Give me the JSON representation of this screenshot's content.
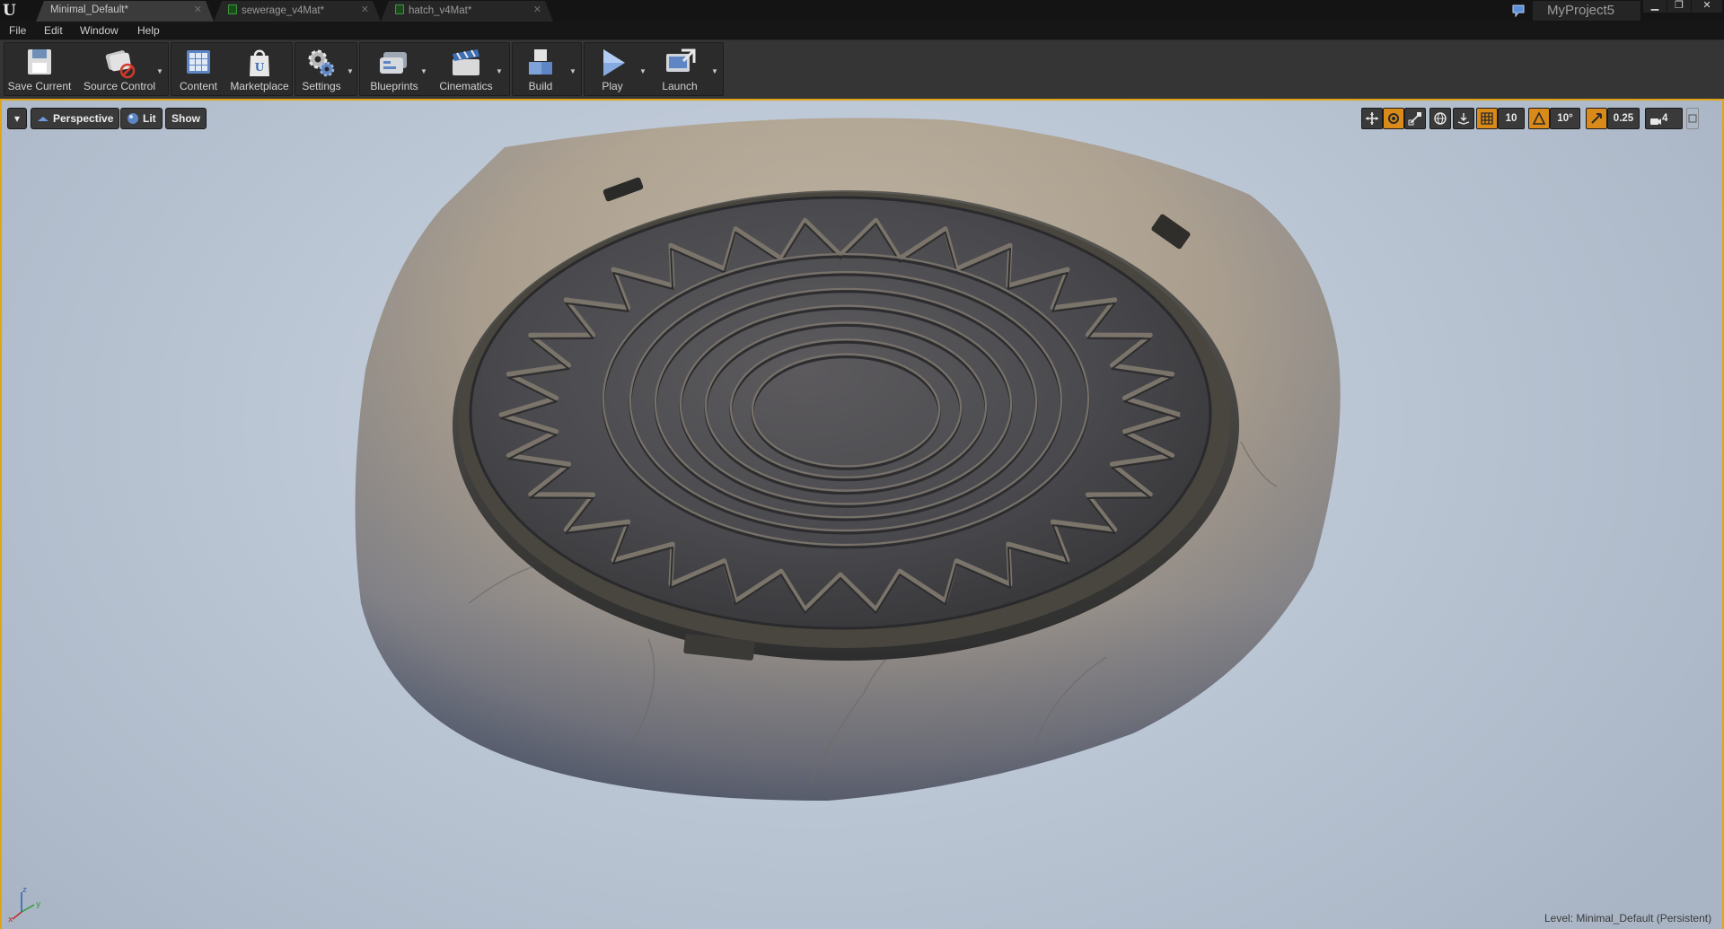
{
  "titlebar": {
    "tabs": [
      {
        "label": "Minimal_Default*",
        "active": true
      },
      {
        "label": "sewerage_v4Mat*",
        "active": false
      },
      {
        "label": "hatch_v4Mat*",
        "active": false
      }
    ],
    "project_name": "MyProject5",
    "window_buttons": [
      "minimize-icon",
      "restore-icon",
      "close-icon"
    ]
  },
  "menu": {
    "items": [
      "File",
      "Edit",
      "Window",
      "Help"
    ]
  },
  "toolbar": {
    "buttons": [
      {
        "label": "Save Current",
        "icon": "save-icon"
      },
      {
        "label": "Source Control",
        "icon": "source-control-icon"
      },
      {
        "label": "Content",
        "icon": "content-browser-icon"
      },
      {
        "label": "Marketplace",
        "icon": "marketplace-icon"
      },
      {
        "label": "Settings",
        "icon": "settings-gears-icon"
      },
      {
        "label": "Blueprints",
        "icon": "blueprints-icon"
      },
      {
        "label": "Cinematics",
        "icon": "clapperboard-icon"
      },
      {
        "label": "Build",
        "icon": "build-blocks-icon"
      },
      {
        "label": "Play",
        "icon": "play-icon"
      },
      {
        "label": "Launch",
        "icon": "launch-icon"
      }
    ]
  },
  "viewport": {
    "options_menu": "▾",
    "view_mode": "Perspective",
    "lighting_mode": "Lit",
    "show_label": "Show",
    "grid_snap_value": "10",
    "rotation_snap_value": "10°",
    "scale_snap_value": "0.25",
    "camera_speed_value": "4",
    "level_label": "Level:",
    "level_name": "Minimal_Default (Persistent)",
    "accent_color": "#e0a418",
    "active_tool_color": "#d98a18"
  },
  "scene": {
    "subject": "manhole-cover-mesh"
  }
}
